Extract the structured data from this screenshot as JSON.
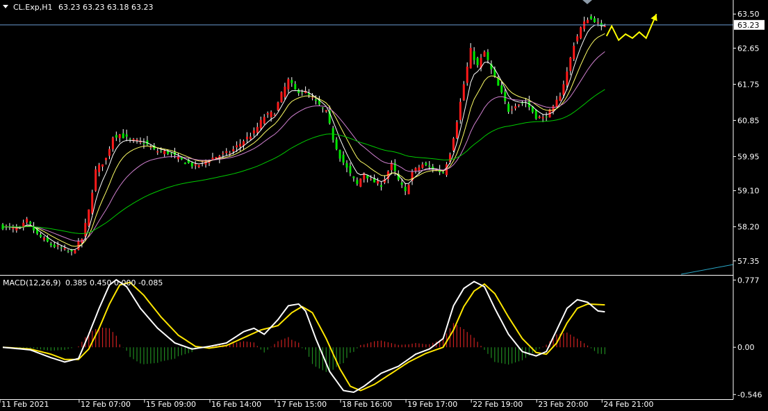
{
  "header": {
    "symbol": "CL.Exp,H1",
    "ohlc": "63.23 63.23 63.18 63.23"
  },
  "macd_header": {
    "label": "MACD(12,26,9)",
    "values": "0.385 0.450 0.000 -0.085"
  },
  "colors": {
    "background": "#000000",
    "bull": "#ff1a1a",
    "bear": "#00e600",
    "wick": "#ffffff",
    "ema_fast": "#ffffff",
    "ema_mid": "#ffff66",
    "ema_slow": "#d080d0",
    "ema_long": "#00cc00",
    "macd_line": "#ffffff",
    "signal_line": "#ffe600",
    "hist_pos": "#cc2020",
    "hist_neg": "#208a20",
    "forecast": "#ffff00",
    "current_line": "#6a9bd1",
    "trend_line": "#2aa8c8",
    "axis": "#ffffff"
  },
  "chart_data": [
    {
      "type": "candlestick",
      "name": "price",
      "ylim": [
        57.0,
        63.85
      ],
      "y_ticks": [
        63.5,
        62.65,
        61.75,
        60.85,
        59.95,
        59.1,
        58.2,
        57.35
      ],
      "current_price": 63.23,
      "bar_count": 210,
      "x_ticks": [
        {
          "index": 0,
          "label": "11 Feb 2021"
        },
        {
          "index": 23,
          "label": "12 Feb 07:00"
        },
        {
          "index": 42,
          "label": "15 Feb 09:00"
        },
        {
          "index": 61,
          "label": "16 Feb 14:00"
        },
        {
          "index": 80,
          "label": "17 Feb 15:00"
        },
        {
          "index": 99,
          "label": "18 Feb 16:00"
        },
        {
          "index": 118,
          "label": "19 Feb 17:00"
        },
        {
          "index": 137,
          "label": "22 Feb 19:00"
        },
        {
          "index": 156,
          "label": "23 Feb 20:00"
        },
        {
          "index": 175,
          "label": "24 Feb 21:00"
        }
      ],
      "close_path": [
        [
          0,
          58.2
        ],
        [
          5,
          58.15
        ],
        [
          7,
          58.35
        ],
        [
          10,
          58.0
        ],
        [
          14,
          57.75
        ],
        [
          20,
          57.55
        ],
        [
          23,
          57.9
        ],
        [
          25,
          58.6
        ],
        [
          27,
          59.6
        ],
        [
          30,
          59.9
        ],
        [
          32,
          60.45
        ],
        [
          34,
          60.5
        ],
        [
          37,
          60.35
        ],
        [
          41,
          60.3
        ],
        [
          44,
          60.1
        ],
        [
          48,
          60.05
        ],
        [
          52,
          59.85
        ],
        [
          56,
          59.7
        ],
        [
          59,
          59.85
        ],
        [
          62,
          59.95
        ],
        [
          66,
          60.05
        ],
        [
          70,
          60.35
        ],
        [
          73,
          60.55
        ],
        [
          76,
          60.95
        ],
        [
          79,
          61.05
        ],
        [
          81,
          61.5
        ],
        [
          83,
          61.85
        ],
        [
          85,
          61.6
        ],
        [
          88,
          61.55
        ],
        [
          91,
          61.3
        ],
        [
          94,
          61.05
        ],
        [
          96,
          60.4
        ],
        [
          98,
          59.95
        ],
        [
          101,
          59.5
        ],
        [
          103,
          59.25
        ],
        [
          105,
          59.55
        ],
        [
          107,
          59.35
        ],
        [
          110,
          59.25
        ],
        [
          113,
          59.75
        ],
        [
          115,
          59.35
        ],
        [
          117,
          59.05
        ],
        [
          119,
          59.55
        ],
        [
          122,
          59.75
        ],
        [
          125,
          59.65
        ],
        [
          128,
          59.55
        ],
        [
          130,
          60.05
        ],
        [
          132,
          60.85
        ],
        [
          134,
          61.75
        ],
        [
          136,
          62.6
        ],
        [
          138,
          62.2
        ],
        [
          140,
          62.55
        ],
        [
          142,
          62.1
        ],
        [
          144,
          61.7
        ],
        [
          147,
          61.1
        ],
        [
          149,
          61.25
        ],
        [
          152,
          61.3
        ],
        [
          155,
          60.95
        ],
        [
          157,
          60.9
        ],
        [
          160,
          61.15
        ],
        [
          162,
          61.5
        ],
        [
          164,
          62.05
        ],
        [
          166,
          62.75
        ],
        [
          168,
          63.15
        ],
        [
          170,
          63.4
        ],
        [
          172,
          63.35
        ],
        [
          174,
          63.15
        ],
        [
          175,
          63.23
        ]
      ],
      "indicators_note": "",
      "forecast_path": [
        [
          175.5,
          62.95
        ],
        [
          177,
          63.2
        ],
        [
          179,
          62.85
        ],
        [
          181,
          63.0
        ],
        [
          183,
          62.9
        ],
        [
          185,
          63.05
        ],
        [
          187,
          62.9
        ],
        [
          190,
          63.5
        ]
      ]
    },
    {
      "type": "macd",
      "name": "MACD(12,26,9)",
      "ylim": [
        -0.6,
        0.82
      ],
      "y_ticks": [
        0.777,
        0.0,
        -0.546
      ],
      "macd_path": [
        [
          0,
          0.0
        ],
        [
          8,
          -0.03
        ],
        [
          14,
          -0.12
        ],
        [
          18,
          -0.17
        ],
        [
          22,
          -0.13
        ],
        [
          25,
          0.15
        ],
        [
          28,
          0.45
        ],
        [
          31,
          0.72
        ],
        [
          33,
          0.78
        ],
        [
          36,
          0.7
        ],
        [
          40,
          0.45
        ],
        [
          45,
          0.22
        ],
        [
          50,
          0.05
        ],
        [
          55,
          -0.02
        ],
        [
          60,
          0.01
        ],
        [
          65,
          0.05
        ],
        [
          70,
          0.18
        ],
        [
          73,
          0.22
        ],
        [
          76,
          0.15
        ],
        [
          80,
          0.32
        ],
        [
          83,
          0.48
        ],
        [
          86,
          0.5
        ],
        [
          88,
          0.42
        ],
        [
          91,
          0.1
        ],
        [
          95,
          -0.28
        ],
        [
          99,
          -0.5
        ],
        [
          102,
          -0.52
        ],
        [
          105,
          -0.45
        ],
        [
          110,
          -0.3
        ],
        [
          115,
          -0.22
        ],
        [
          120,
          -0.08
        ],
        [
          124,
          -0.02
        ],
        [
          128,
          0.1
        ],
        [
          131,
          0.48
        ],
        [
          134,
          0.68
        ],
        [
          137,
          0.76
        ],
        [
          140,
          0.7
        ],
        [
          143,
          0.45
        ],
        [
          147,
          0.15
        ],
        [
          151,
          -0.05
        ],
        [
          155,
          -0.1
        ],
        [
          158,
          -0.05
        ],
        [
          161,
          0.2
        ],
        [
          164,
          0.45
        ],
        [
          167,
          0.55
        ],
        [
          170,
          0.52
        ],
        [
          173,
          0.42
        ],
        [
          175,
          0.41
        ]
      ],
      "signal_path": [
        [
          0,
          0.0
        ],
        [
          8,
          -0.02
        ],
        [
          14,
          -0.08
        ],
        [
          18,
          -0.14
        ],
        [
          22,
          -0.14
        ],
        [
          25,
          -0.02
        ],
        [
          28,
          0.22
        ],
        [
          31,
          0.5
        ],
        [
          34,
          0.72
        ],
        [
          37,
          0.75
        ],
        [
          41,
          0.6
        ],
        [
          46,
          0.35
        ],
        [
          51,
          0.14
        ],
        [
          56,
          0.01
        ],
        [
          60,
          -0.01
        ],
        [
          65,
          0.02
        ],
        [
          70,
          0.11
        ],
        [
          75,
          0.2
        ],
        [
          80,
          0.25
        ],
        [
          84,
          0.4
        ],
        [
          87,
          0.47
        ],
        [
          90,
          0.4
        ],
        [
          94,
          0.1
        ],
        [
          98,
          -0.25
        ],
        [
          101,
          -0.45
        ],
        [
          104,
          -0.5
        ],
        [
          108,
          -0.43
        ],
        [
          113,
          -0.3
        ],
        [
          118,
          -0.17
        ],
        [
          123,
          -0.07
        ],
        [
          128,
          0.0
        ],
        [
          131,
          0.2
        ],
        [
          134,
          0.47
        ],
        [
          137,
          0.65
        ],
        [
          140,
          0.73
        ],
        [
          143,
          0.62
        ],
        [
          147,
          0.35
        ],
        [
          151,
          0.1
        ],
        [
          155,
          -0.06
        ],
        [
          158,
          -0.08
        ],
        [
          161,
          0.05
        ],
        [
          164,
          0.28
        ],
        [
          167,
          0.45
        ],
        [
          170,
          0.5
        ],
        [
          175,
          0.49
        ]
      ]
    }
  ]
}
